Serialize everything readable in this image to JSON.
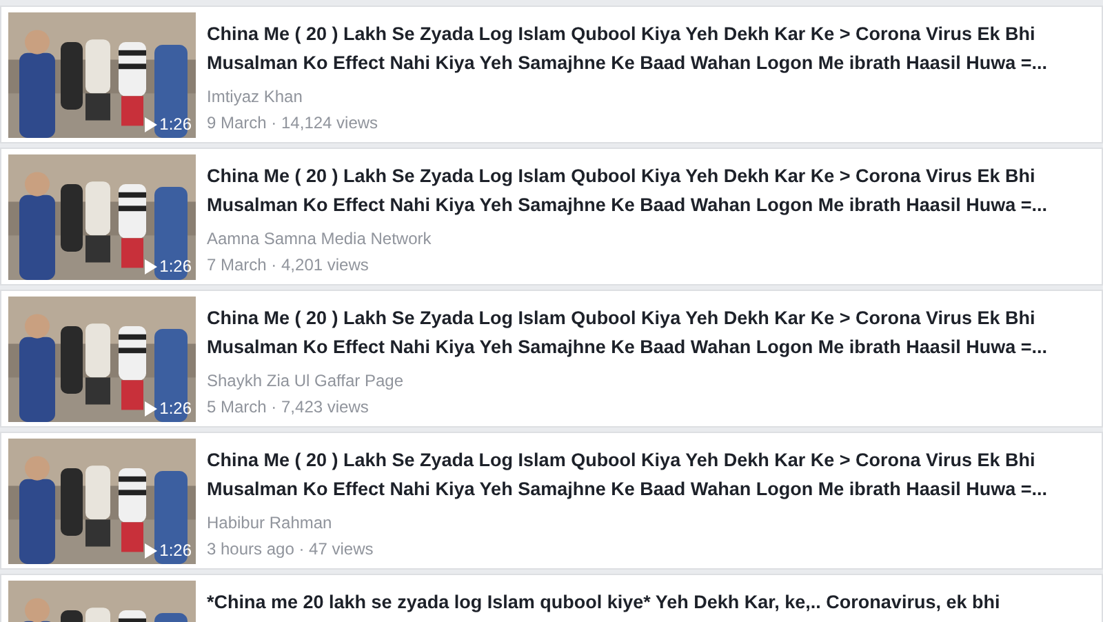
{
  "videos": [
    {
      "title": "China Me ( 20 ) Lakh Se Zyada Log Islam Qubool Kiya Yeh Dekh Kar Ke > Corona Virus Ek Bhi Musalman Ko Effect Nahi Kiya Yeh Samajhne Ke Baad Wahan Logon Me ibrath Haasil Huwa =...",
      "channel": "Imtiyaz Khan",
      "meta": "9 March · 14,124 views",
      "duration": "1:26"
    },
    {
      "title": "China Me ( 20 ) Lakh Se Zyada Log Islam Qubool Kiya Yeh Dekh Kar Ke > Corona Virus Ek Bhi Musalman Ko Effect Nahi Kiya Yeh Samajhne Ke Baad Wahan Logon Me ibrath Haasil Huwa =...",
      "channel": "Aamna Samna Media Network",
      "meta": "7 March · 4,201 views",
      "duration": "1:26"
    },
    {
      "title": "China Me ( 20 ) Lakh Se Zyada Log Islam Qubool Kiya Yeh Dekh Kar Ke > Corona Virus Ek Bhi Musalman Ko Effect Nahi Kiya Yeh Samajhne Ke Baad Wahan Logon Me ibrath Haasil Huwa =...",
      "channel": "Shaykh Zia Ul Gaffar Page",
      "meta": "5 March · 7,423 views",
      "duration": "1:26"
    },
    {
      "title": "China Me ( 20 ) Lakh Se Zyada Log Islam Qubool Kiya Yeh Dekh Kar Ke > Corona Virus Ek Bhi Musalman Ko Effect Nahi Kiya Yeh Samajhne Ke Baad Wahan Logon Me ibrath Haasil Huwa =...",
      "channel": "Habibur Rahman",
      "meta": "3 hours ago · 47 views",
      "duration": "1:26"
    },
    {
      "title": "*China me 20 lakh se zyada log Islam qubool kiye* Yeh Dekh Kar, ke,.. Coronavirus, ek bhi"
    }
  ]
}
